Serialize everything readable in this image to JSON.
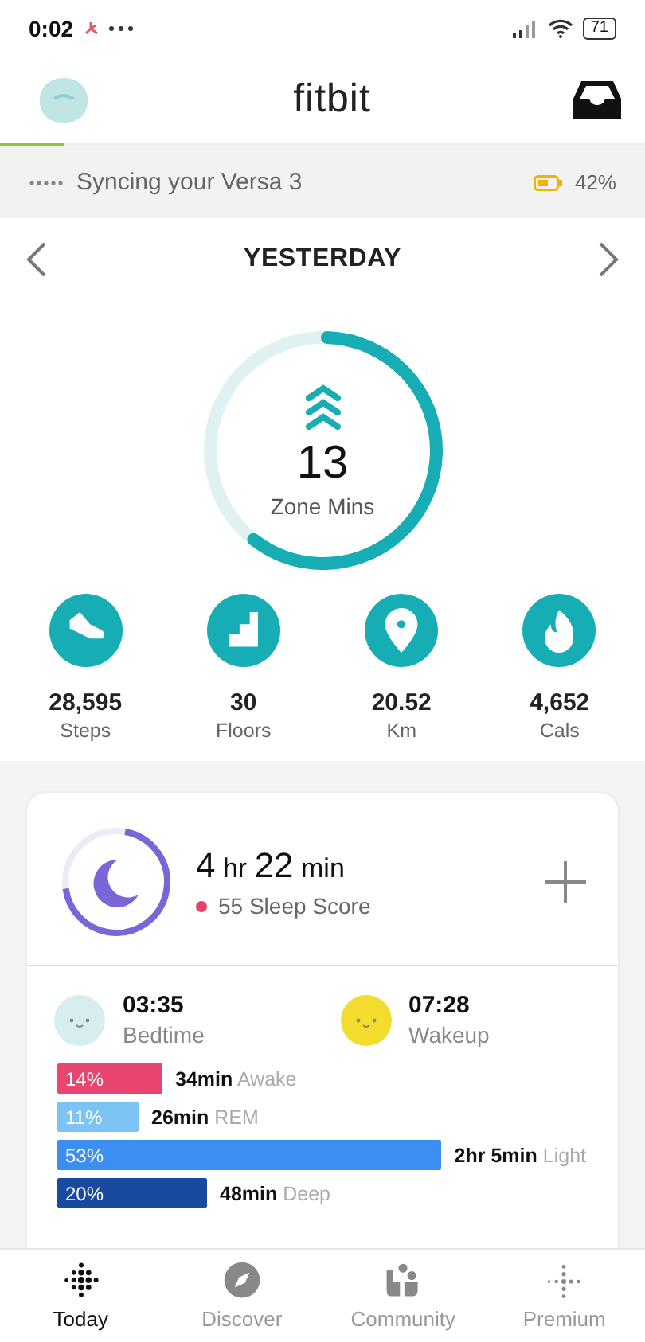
{
  "status_bar": {
    "time": "0:02",
    "battery": "71"
  },
  "header": {
    "title": "fitbit"
  },
  "sync": {
    "text": "Syncing your Versa 3",
    "battery": "42%"
  },
  "date_nav": {
    "label": "YESTERDAY"
  },
  "zone": {
    "value": "13",
    "label": "Zone Mins",
    "level": 0.6
  },
  "stats": [
    {
      "kind": "steps",
      "value": "28,595",
      "label": "Steps"
    },
    {
      "kind": "floors",
      "value": "30",
      "label": "Floors"
    },
    {
      "kind": "distance",
      "value": "20.52",
      "label": "Km"
    },
    {
      "kind": "calories",
      "value": "4,652",
      "label": "Cals"
    }
  ],
  "sleep": {
    "duration": {
      "hours": "4",
      "hours_unit": "hr",
      "minutes": "22",
      "minutes_unit": "min"
    },
    "score": "55 Sleep Score",
    "level": 0.7,
    "bedtime": {
      "time": "03:35",
      "label": "Bedtime"
    },
    "wakeup": {
      "time": "07:28",
      "label": "Wakeup"
    },
    "stages": [
      {
        "percent": "14%",
        "duration": "34min",
        "label": "Awake",
        "color": "#e8456f"
      },
      {
        "percent": "11%",
        "duration": "26min",
        "label": "REM",
        "color": "#7cc4f4"
      },
      {
        "percent": "53%",
        "duration": "2hr 5min",
        "label": "Light",
        "color": "#3c8ef0"
      },
      {
        "percent": "20%",
        "duration": "48min",
        "label": "Deep",
        "color": "#1a4aa0"
      }
    ]
  },
  "nav": [
    {
      "kind": "today",
      "label": "Today",
      "selected": true
    },
    {
      "kind": "discover",
      "label": "Discover",
      "selected": false
    },
    {
      "kind": "community",
      "label": "Community",
      "selected": false
    },
    {
      "kind": "premium",
      "label": "Premium",
      "selected": false
    }
  ]
}
